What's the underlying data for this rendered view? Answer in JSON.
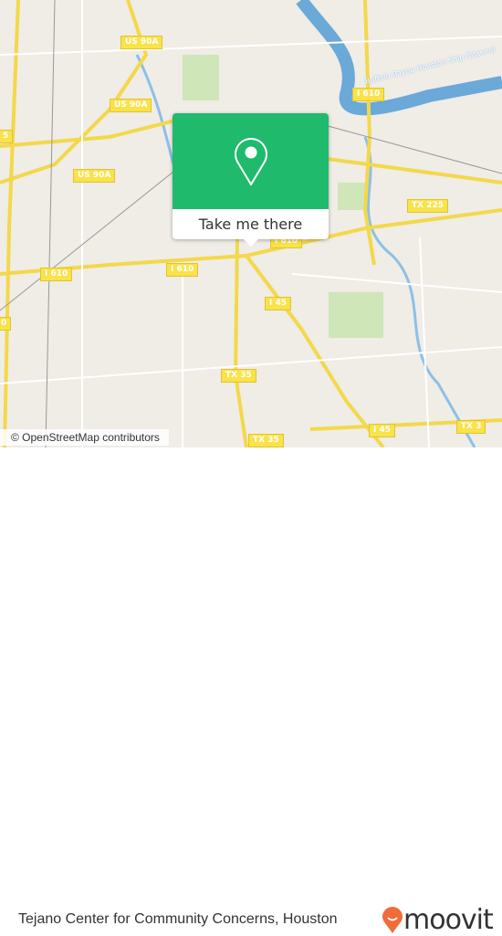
{
  "map": {
    "attribution": "© OpenStreetMap contributors",
    "water_label": "Buffalo Bayou Houston Ship Channel",
    "road_labels": [
      "I 610",
      "US 90A",
      "US 90A",
      "US 90A",
      "I 610",
      "I 610",
      "I 610",
      "I 45",
      "TX 35",
      "TX 35",
      "I 45",
      "TX 3",
      "TX 225",
      "5",
      "0"
    ],
    "colors": {
      "land": "#f0ece6",
      "road": "#f9e24a",
      "water": "#6aa9d8",
      "park": "#cfe6b8"
    }
  },
  "popup": {
    "button_label": "Take me there",
    "icon": "map-pin-icon",
    "color": "#1fba6c"
  },
  "footer": {
    "title": "Tejano Center for Community Concerns, Houston",
    "logo": "moovit",
    "logo_color": "#f26b3a"
  }
}
